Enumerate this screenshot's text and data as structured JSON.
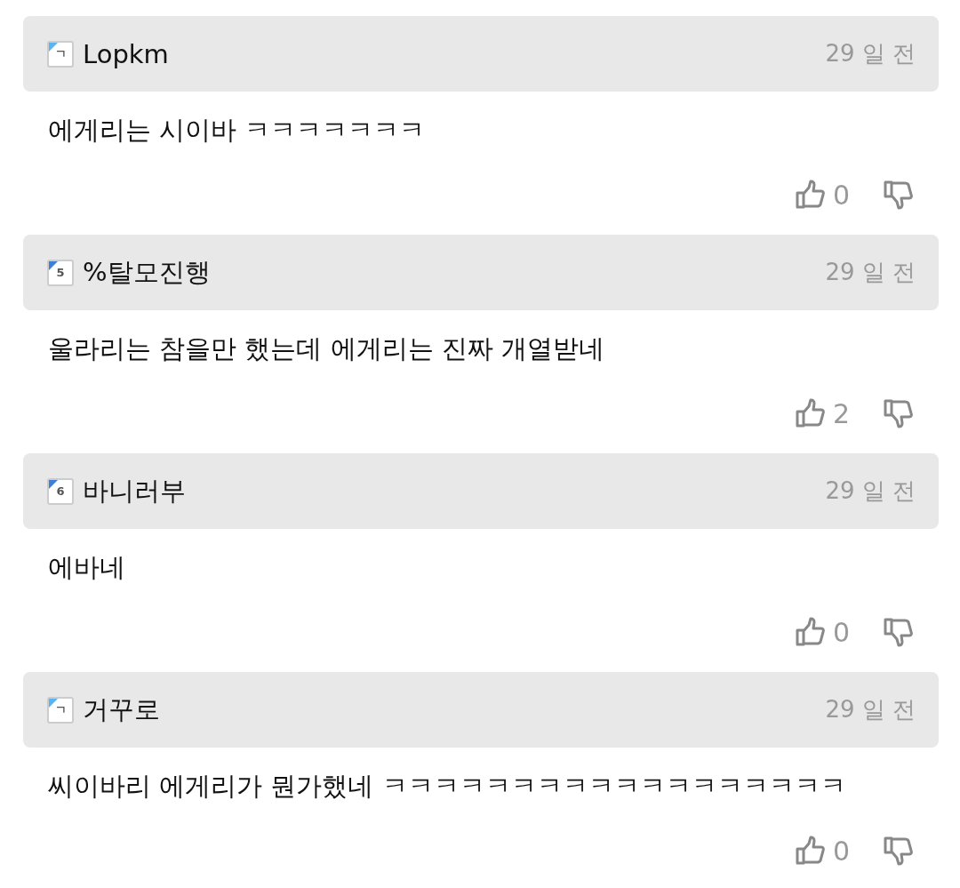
{
  "comments": [
    {
      "badge": {
        "text": "ㄱ",
        "color": "#5ab4f0"
      },
      "author": "Lopkm",
      "time": "29 일 전",
      "text": "에게리는 시이바 ㅋㅋㅋㅋㅋㅋㅋ",
      "likes": "0"
    },
    {
      "badge": {
        "text": "5",
        "color": "#3f7fd6"
      },
      "author": "%탈모진행",
      "time": "29 일 전",
      "text": "울라리는 참을만 했는데 에게리는 진짜 개열받네",
      "likes": "2"
    },
    {
      "badge": {
        "text": "6",
        "color": "#3f7fd6"
      },
      "author": "바니러부",
      "time": "29 일 전",
      "text": "에바네",
      "likes": "0"
    },
    {
      "badge": {
        "text": "ㄱ",
        "color": "#5ab4f0"
      },
      "author": "거꾸로",
      "time": "29 일 전",
      "text": "씨이바리 에게리가 뭔가했네 ㅋㅋㅋㅋㅋㅋㅋㅋㅋㅋㅋㅋㅋㅋㅋㅋㅋㅋ",
      "likes": "0"
    }
  ]
}
